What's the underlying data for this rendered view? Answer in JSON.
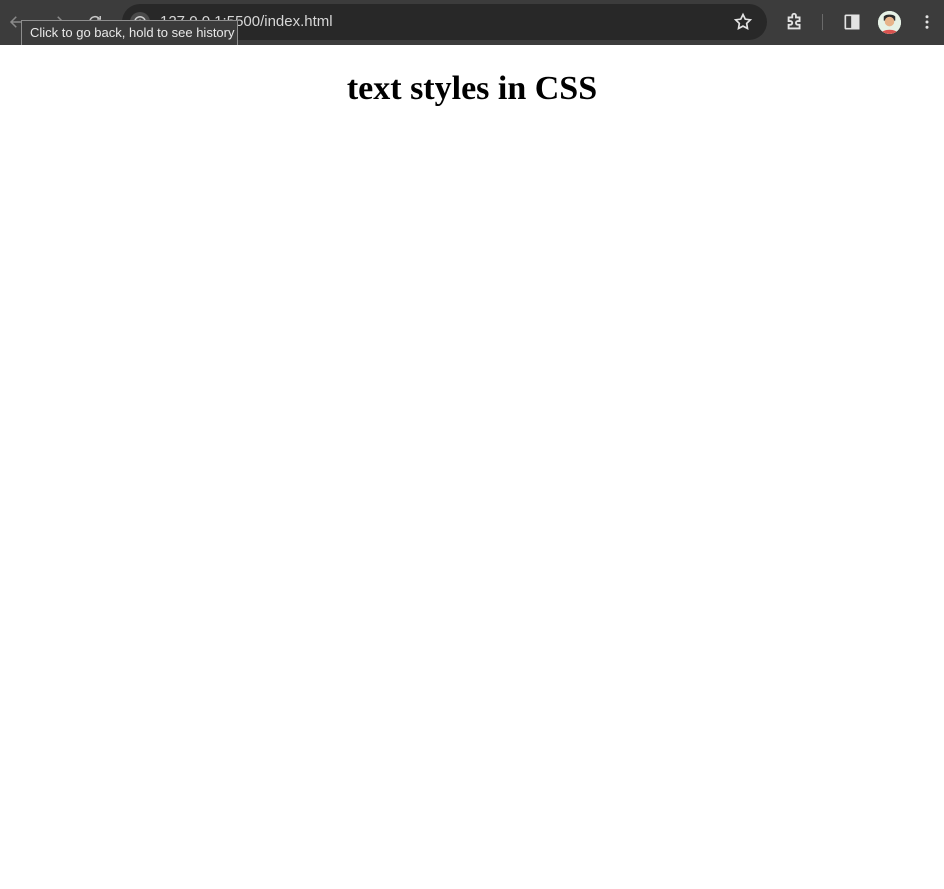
{
  "browser": {
    "url": "127.0.0.1:5500/index.html",
    "tooltip": "Click to go back, hold to see history",
    "icons": {
      "back": "arrow-left-icon",
      "forward": "arrow-right-icon",
      "reload": "reload-icon",
      "site_info": "info-icon",
      "bookmark": "star-icon",
      "extensions": "puzzle-icon",
      "side_panel": "side-panel-icon",
      "profile": "avatar",
      "menu": "kebab-menu-icon"
    },
    "colors": {
      "toolbar": "#3c3c3c",
      "omnibox": "#282828",
      "tooltip_bg": "#3b3b3b"
    }
  },
  "page": {
    "heading": "text styles in CSS"
  }
}
